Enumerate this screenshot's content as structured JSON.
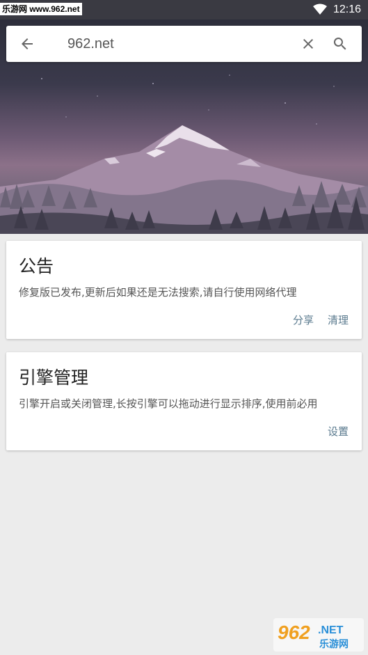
{
  "status_bar": {
    "watermark": "乐游网 www.962.net",
    "time": "12:16",
    "wifi_icon": "wifi-icon"
  },
  "search": {
    "value": "962.net",
    "back_icon": "back-arrow-icon",
    "clear_icon": "close-icon",
    "search_icon": "search-icon"
  },
  "cards": {
    "announcement": {
      "title": "公告",
      "description": "修复版已发布,更新后如果还是无法搜索,请自行使用网络代理",
      "share_label": "分享",
      "clear_label": "清理"
    },
    "engine": {
      "title": "引擎管理",
      "description": "引擎开启或关闭管理,长按引擎可以拖动进行显示排序,使用前必用",
      "settings_label": "设置"
    }
  },
  "watermark_bottom": {
    "brand": "962.NET",
    "subtitle": "乐游网"
  },
  "colors": {
    "status_bar": "#3a3a42",
    "action_text": "#5a7a8e",
    "background": "#ececec"
  }
}
